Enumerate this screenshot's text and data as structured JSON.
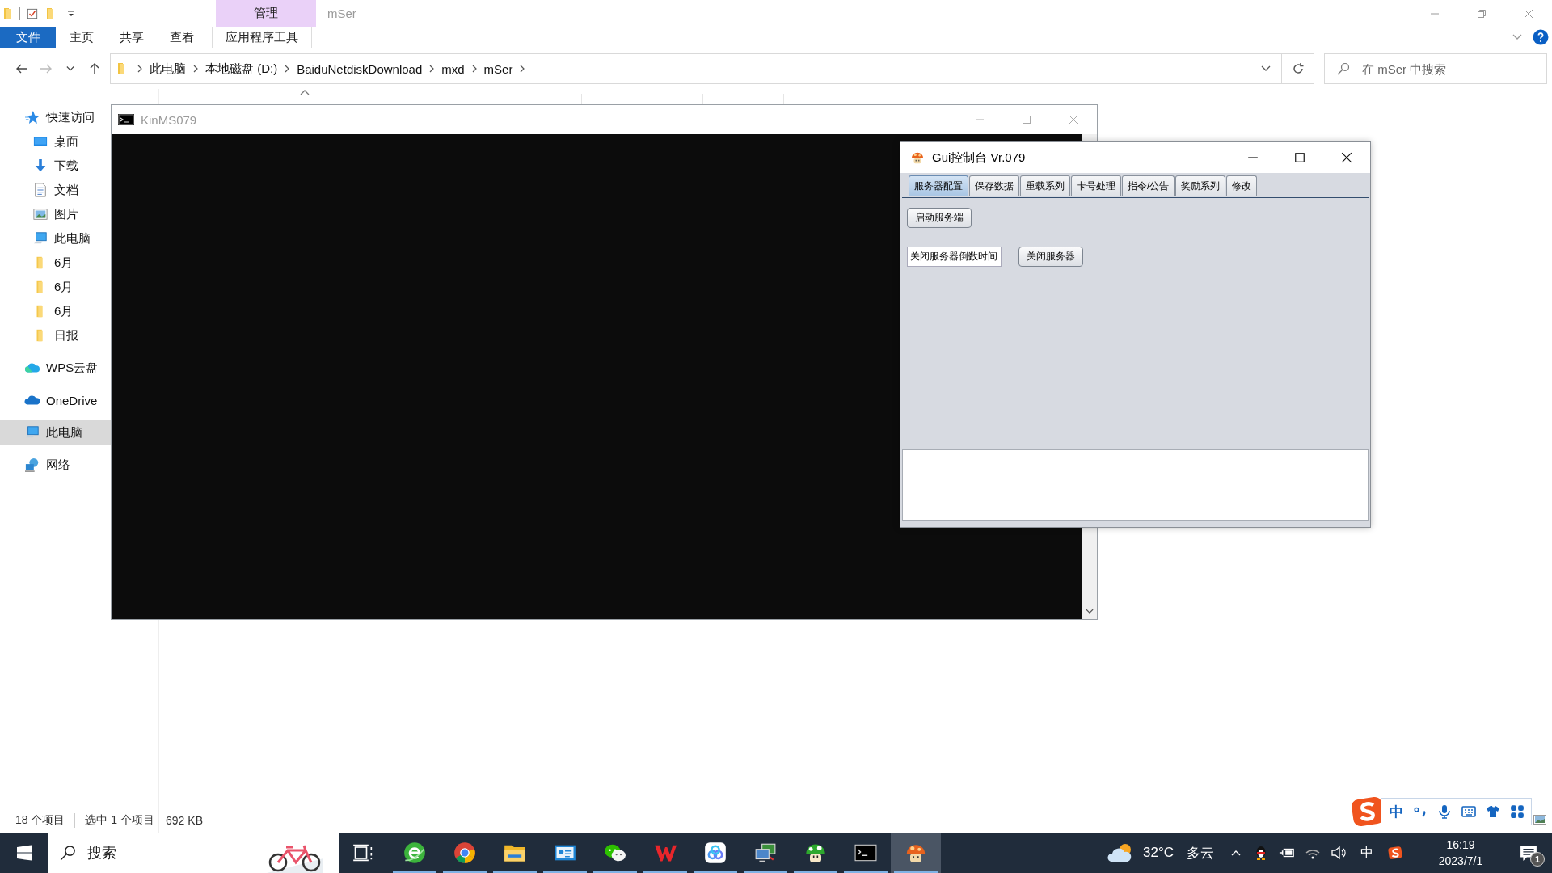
{
  "explorer": {
    "title": "mSer",
    "context_group": "管理",
    "ribbon_tabs": [
      {
        "label": "文件",
        "kind": "file"
      },
      {
        "label": "主页",
        "kind": "normal"
      },
      {
        "label": "共享",
        "kind": "normal"
      },
      {
        "label": "查看",
        "kind": "normal"
      },
      {
        "label": "应用程序工具",
        "kind": "context"
      }
    ],
    "address_path": [
      "此电脑",
      "本地磁盘 (D:)",
      "BaiduNetdiskDownload",
      "mxd",
      "mSer"
    ],
    "search": {
      "placeholder": "在 mSer 中搜索"
    },
    "sidebar": [
      {
        "label": "快速访问",
        "kind": "star",
        "selected": false,
        "children": [
          {
            "label": "桌面",
            "kind": "desktop",
            "selected": false
          },
          {
            "label": "下载",
            "kind": "download",
            "selected": false
          },
          {
            "label": "文档",
            "kind": "document",
            "selected": false
          },
          {
            "label": "图片",
            "kind": "pictures",
            "selected": false
          },
          {
            "label": "此电脑",
            "kind": "computer",
            "selected": false
          },
          {
            "label": "6月",
            "kind": "folder",
            "selected": false
          },
          {
            "label": "6月",
            "kind": "folder",
            "selected": false
          },
          {
            "label": "6月",
            "kind": "folder",
            "selected": false
          },
          {
            "label": "日报",
            "kind": "folder",
            "selected": false
          }
        ]
      },
      {
        "label": "WPS云盘",
        "kind": "wps-cloud",
        "selected": false
      },
      {
        "label": "OneDrive",
        "kind": "onedrive",
        "selected": false
      },
      {
        "label": "此电脑",
        "kind": "computer",
        "selected": true
      },
      {
        "label": "网络",
        "kind": "network",
        "selected": false
      }
    ],
    "status_bar": [
      "18 个项目",
      "选中 1 个项目",
      "692 KB"
    ]
  },
  "console_window": {
    "title": "KinMS079"
  },
  "gui_window": {
    "title": "Gui控制台 Vr.079",
    "tabs": [
      {
        "label": "服务器配置",
        "selected": true
      },
      {
        "label": "保存数据",
        "selected": false
      },
      {
        "label": "重载系列",
        "selected": false
      },
      {
        "label": "卡号处理",
        "selected": false
      },
      {
        "label": "指令/公告",
        "selected": false
      },
      {
        "label": "奖励系列",
        "selected": false
      },
      {
        "label": "修改",
        "selected": false
      }
    ],
    "start_button": "启动服务端",
    "countdown_field": {
      "value": "关闭服务器倒数时间"
    },
    "shutdown_button": "关闭服务器"
  },
  "ime_bar": {
    "mode": "中"
  },
  "taskbar": {
    "search": {
      "placeholder": "搜索"
    },
    "apps": [
      {
        "kind": "task-view",
        "running": false,
        "active": false
      },
      {
        "kind": "green-browser",
        "running": true,
        "active": false
      },
      {
        "kind": "chrome",
        "running": true,
        "active": false
      },
      {
        "kind": "file-explorer",
        "running": true,
        "active": false
      },
      {
        "kind": "contact-card",
        "running": true,
        "active": false
      },
      {
        "kind": "wechat",
        "running": true,
        "active": false
      },
      {
        "kind": "wps",
        "running": true,
        "active": false
      },
      {
        "kind": "cloud-drive",
        "running": true,
        "active": false
      },
      {
        "kind": "remote-desktop",
        "running": true,
        "active": false
      },
      {
        "kind": "green-mushroom",
        "running": true,
        "active": false
      },
      {
        "kind": "terminal",
        "running": true,
        "active": false
      },
      {
        "kind": "orange-mushroom",
        "running": true,
        "active": true
      }
    ],
    "weather": {
      "temperature": "32°C",
      "condition": "多云"
    },
    "input_indicator": "中",
    "time": "16:19",
    "date": "2023/7/1",
    "notifications": "1"
  }
}
